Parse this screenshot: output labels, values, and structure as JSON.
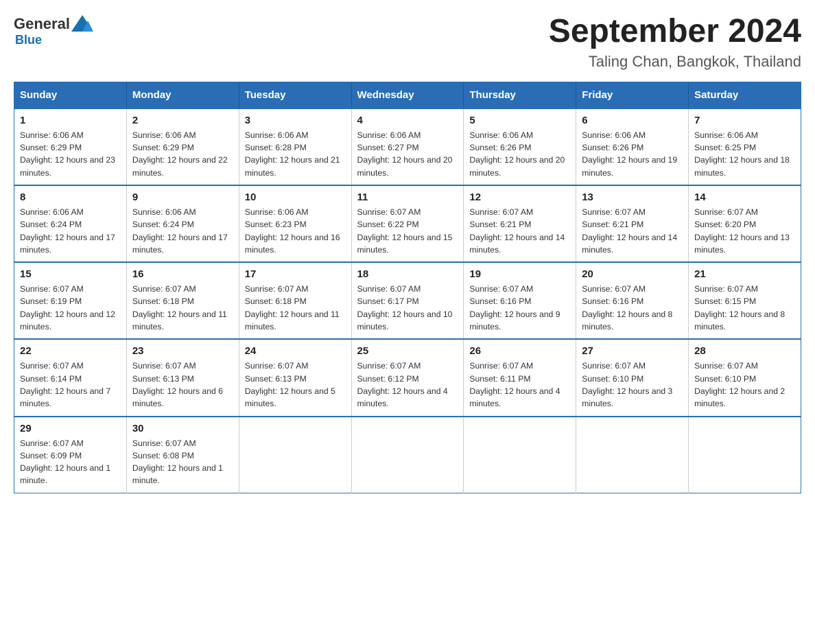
{
  "header": {
    "logo_general": "General",
    "logo_blue": "Blue",
    "title": "September 2024",
    "subtitle": "Taling Chan, Bangkok, Thailand"
  },
  "calendar": {
    "days_of_week": [
      "Sunday",
      "Monday",
      "Tuesday",
      "Wednesday",
      "Thursday",
      "Friday",
      "Saturday"
    ],
    "weeks": [
      [
        {
          "day": "1",
          "sunrise": "6:06 AM",
          "sunset": "6:29 PM",
          "daylight": "12 hours and 23 minutes."
        },
        {
          "day": "2",
          "sunrise": "6:06 AM",
          "sunset": "6:29 PM",
          "daylight": "12 hours and 22 minutes."
        },
        {
          "day": "3",
          "sunrise": "6:06 AM",
          "sunset": "6:28 PM",
          "daylight": "12 hours and 21 minutes."
        },
        {
          "day": "4",
          "sunrise": "6:06 AM",
          "sunset": "6:27 PM",
          "daylight": "12 hours and 20 minutes."
        },
        {
          "day": "5",
          "sunrise": "6:06 AM",
          "sunset": "6:26 PM",
          "daylight": "12 hours and 20 minutes."
        },
        {
          "day": "6",
          "sunrise": "6:06 AM",
          "sunset": "6:26 PM",
          "daylight": "12 hours and 19 minutes."
        },
        {
          "day": "7",
          "sunrise": "6:06 AM",
          "sunset": "6:25 PM",
          "daylight": "12 hours and 18 minutes."
        }
      ],
      [
        {
          "day": "8",
          "sunrise": "6:06 AM",
          "sunset": "6:24 PM",
          "daylight": "12 hours and 17 minutes."
        },
        {
          "day": "9",
          "sunrise": "6:06 AM",
          "sunset": "6:24 PM",
          "daylight": "12 hours and 17 minutes."
        },
        {
          "day": "10",
          "sunrise": "6:06 AM",
          "sunset": "6:23 PM",
          "daylight": "12 hours and 16 minutes."
        },
        {
          "day": "11",
          "sunrise": "6:07 AM",
          "sunset": "6:22 PM",
          "daylight": "12 hours and 15 minutes."
        },
        {
          "day": "12",
          "sunrise": "6:07 AM",
          "sunset": "6:21 PM",
          "daylight": "12 hours and 14 minutes."
        },
        {
          "day": "13",
          "sunrise": "6:07 AM",
          "sunset": "6:21 PM",
          "daylight": "12 hours and 14 minutes."
        },
        {
          "day": "14",
          "sunrise": "6:07 AM",
          "sunset": "6:20 PM",
          "daylight": "12 hours and 13 minutes."
        }
      ],
      [
        {
          "day": "15",
          "sunrise": "6:07 AM",
          "sunset": "6:19 PM",
          "daylight": "12 hours and 12 minutes."
        },
        {
          "day": "16",
          "sunrise": "6:07 AM",
          "sunset": "6:18 PM",
          "daylight": "12 hours and 11 minutes."
        },
        {
          "day": "17",
          "sunrise": "6:07 AM",
          "sunset": "6:18 PM",
          "daylight": "12 hours and 11 minutes."
        },
        {
          "day": "18",
          "sunrise": "6:07 AM",
          "sunset": "6:17 PM",
          "daylight": "12 hours and 10 minutes."
        },
        {
          "day": "19",
          "sunrise": "6:07 AM",
          "sunset": "6:16 PM",
          "daylight": "12 hours and 9 minutes."
        },
        {
          "day": "20",
          "sunrise": "6:07 AM",
          "sunset": "6:16 PM",
          "daylight": "12 hours and 8 minutes."
        },
        {
          "day": "21",
          "sunrise": "6:07 AM",
          "sunset": "6:15 PM",
          "daylight": "12 hours and 8 minutes."
        }
      ],
      [
        {
          "day": "22",
          "sunrise": "6:07 AM",
          "sunset": "6:14 PM",
          "daylight": "12 hours and 7 minutes."
        },
        {
          "day": "23",
          "sunrise": "6:07 AM",
          "sunset": "6:13 PM",
          "daylight": "12 hours and 6 minutes."
        },
        {
          "day": "24",
          "sunrise": "6:07 AM",
          "sunset": "6:13 PM",
          "daylight": "12 hours and 5 minutes."
        },
        {
          "day": "25",
          "sunrise": "6:07 AM",
          "sunset": "6:12 PM",
          "daylight": "12 hours and 4 minutes."
        },
        {
          "day": "26",
          "sunrise": "6:07 AM",
          "sunset": "6:11 PM",
          "daylight": "12 hours and 4 minutes."
        },
        {
          "day": "27",
          "sunrise": "6:07 AM",
          "sunset": "6:10 PM",
          "daylight": "12 hours and 3 minutes."
        },
        {
          "day": "28",
          "sunrise": "6:07 AM",
          "sunset": "6:10 PM",
          "daylight": "12 hours and 2 minutes."
        }
      ],
      [
        {
          "day": "29",
          "sunrise": "6:07 AM",
          "sunset": "6:09 PM",
          "daylight": "12 hours and 1 minute."
        },
        {
          "day": "30",
          "sunrise": "6:07 AM",
          "sunset": "6:08 PM",
          "daylight": "12 hours and 1 minute."
        },
        null,
        null,
        null,
        null,
        null
      ]
    ]
  }
}
